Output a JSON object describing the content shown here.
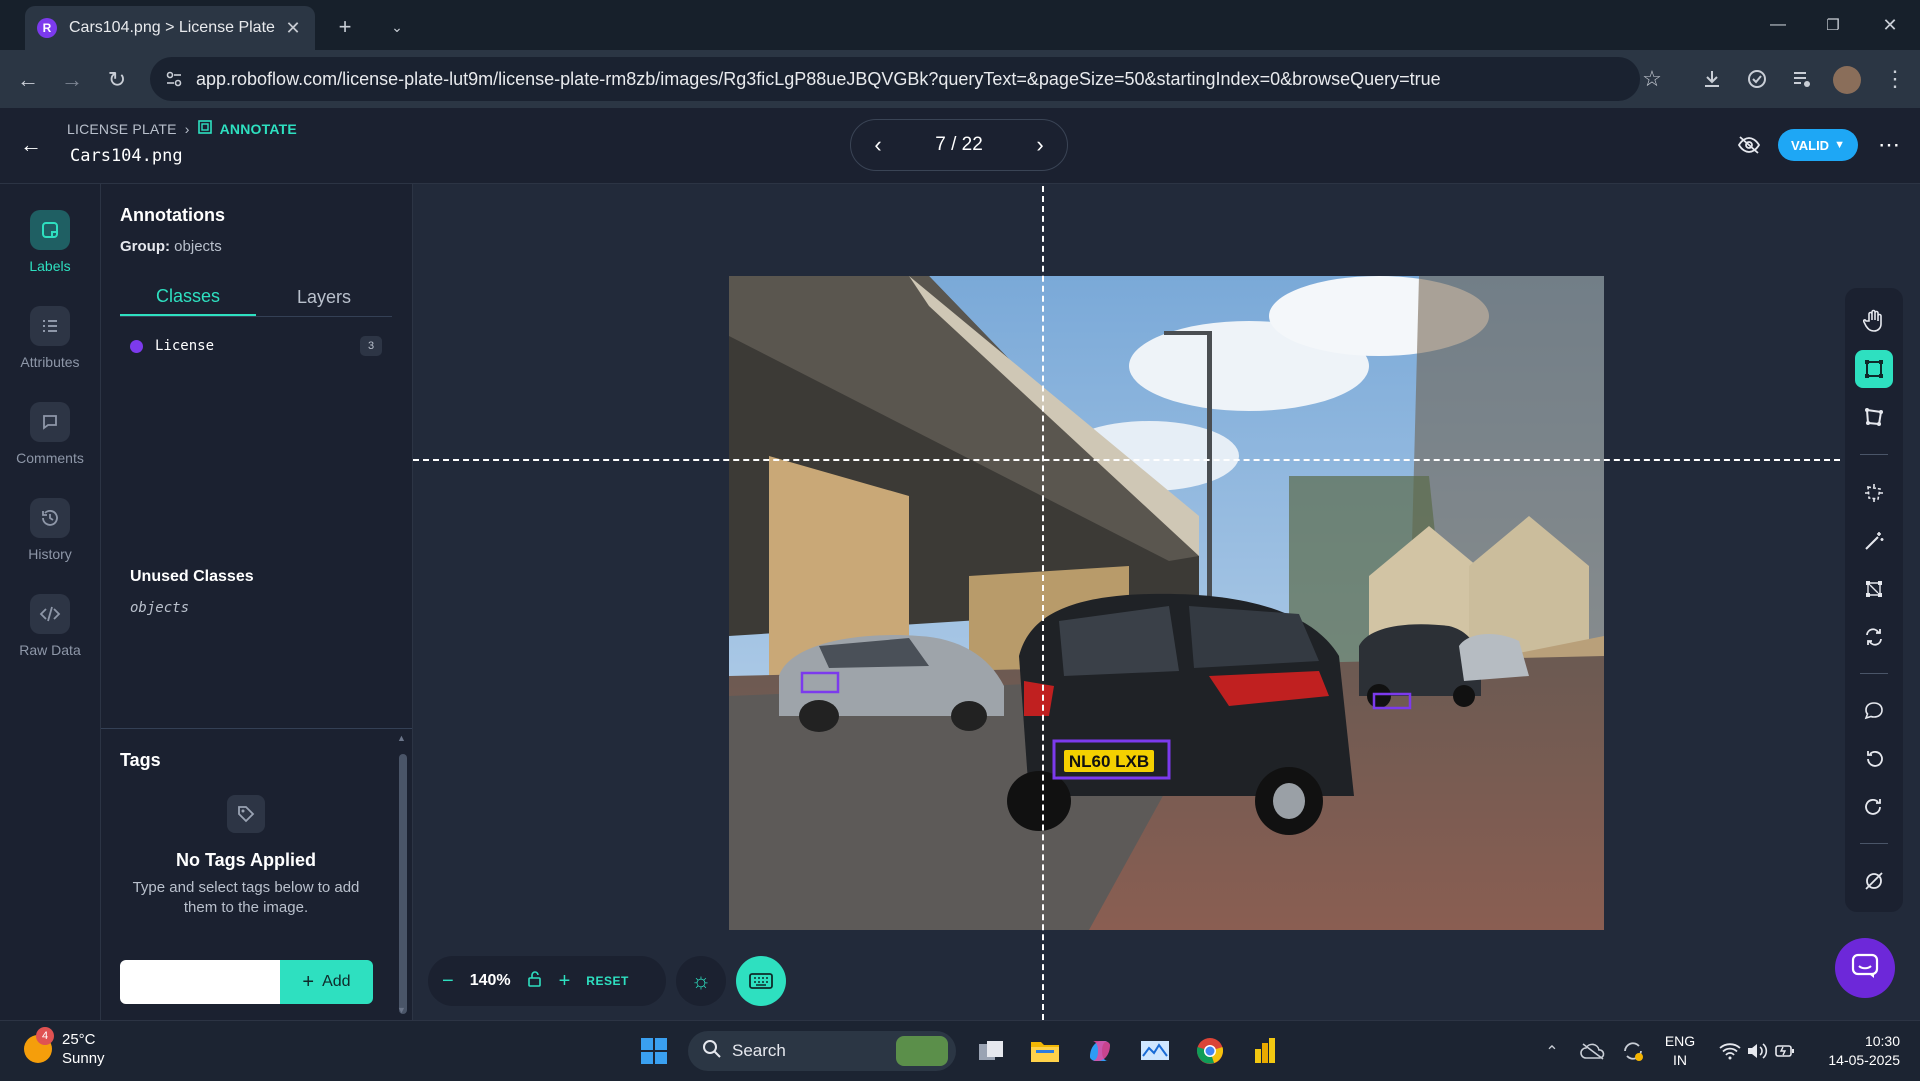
{
  "browser": {
    "tab_title": "Cars104.png > License Plate",
    "url": "app.roboflow.com/license-plate-lut9m/license-plate-rm8zb/images/Rg3ficLgP88ueJBQVGBk?queryText=&pageSize=50&startingIndex=0&browseQuery=true"
  },
  "header": {
    "crumb_project": "LICENSE PLATE",
    "crumb_mode": "ANNOTATE",
    "filename": "Cars104.png",
    "pager": "7 / 22",
    "status": "VALID"
  },
  "rail": {
    "labels": "Labels",
    "attributes": "Attributes",
    "comments": "Comments",
    "history": "History",
    "raw_data": "Raw Data"
  },
  "panel": {
    "title": "Annotations",
    "group_label": "Group:",
    "group_value": "objects",
    "tab_classes": "Classes",
    "tab_layers": "Layers",
    "classes": [
      {
        "name": "License",
        "count": "3",
        "color": "#7c3aed"
      }
    ],
    "unused_title": "Unused Classes",
    "unused_items": [
      "objects"
    ],
    "tags_title": "Tags",
    "no_tags": "No Tags Applied",
    "tags_hint": "Type and select tags below to add them to the image.",
    "tag_input_placeholder": "",
    "add_label": "Add"
  },
  "canvas": {
    "plate_text": "NL60 LXB",
    "annotation_count": 3,
    "annotation_color": "#7c3aed",
    "zoom": "140%",
    "reset": "RESET"
  },
  "toolbar_icons": [
    "hand-icon",
    "bounding-box-icon",
    "polygon-icon",
    "smart-polygon-icon",
    "magic-wand-icon",
    "keypoint-icon",
    "repeat-icon",
    "comment-icon",
    "undo-icon",
    "redo-icon",
    "null-icon"
  ],
  "taskbar": {
    "weather_badge": "4",
    "temperature": "25°C",
    "weather": "Sunny",
    "search": "Search",
    "lang_line1": "ENG",
    "lang_line2": "IN",
    "time": "10:30",
    "date": "14-05-2025"
  },
  "colors": {
    "accent": "#2ee0c0",
    "valid": "#1ea7f5",
    "class": "#7c3aed"
  }
}
